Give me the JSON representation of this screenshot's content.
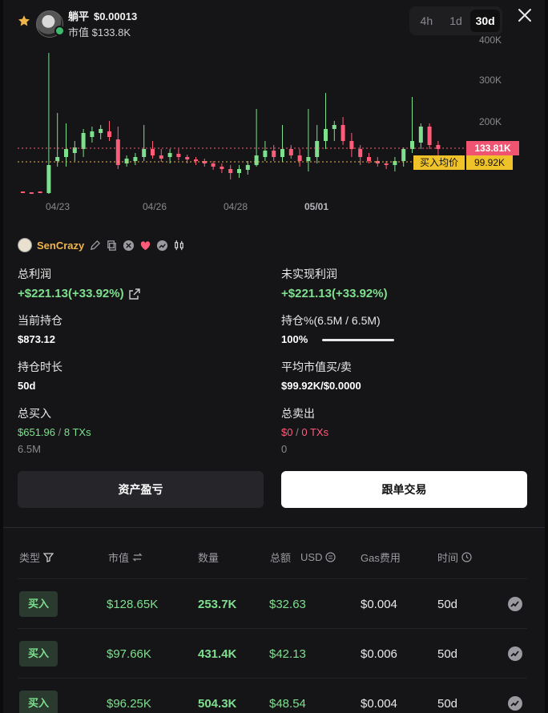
{
  "header": {
    "token_name": "躺平",
    "token_price": "$0.00013",
    "market_cap": "市值 $133.8K",
    "timeframes": [
      "4h",
      "1d",
      "30d"
    ],
    "active_timeframe": "30d"
  },
  "chart_data": {
    "type": "candlestick",
    "y_ticks": [
      "400K",
      "300K",
      "200K"
    ],
    "x_ticks": [
      "04/23",
      "04/26",
      "04/28",
      "05/01"
    ],
    "current_price_label": "133.81K",
    "avg_buy_label": "买入均价",
    "avg_buy_value": "99.92K",
    "up_color": "#7ee08f",
    "down_color": "#ff5c7a"
  },
  "trader": {
    "name": "SenCrazy"
  },
  "stats": {
    "total_profit_label": "总利润",
    "total_profit_value": "+$221.13(+33.92%)",
    "unrealized_label": "未实现利润",
    "unrealized_value": "+$221.13(+33.92%)",
    "holding_label": "当前持仓",
    "holding_value": "$873.12",
    "position_pct_label": "持仓%(6.5M / 6.5M)",
    "position_pct_value": "100%",
    "position_fraction": 1.0,
    "hold_time_label": "持仓时长",
    "hold_time_value": "50d",
    "avg_mcap_label": "平均市值买/卖",
    "avg_mcap_value": "$99.92K/$0.0000",
    "total_buy_label": "总买入",
    "total_buy_amount": "$651.96",
    "total_buy_sep": "/",
    "total_buy_txs": "8 TXs",
    "total_buy_qty": "6.5M",
    "total_sell_label": "总卖出",
    "total_sell_amount": "$0",
    "total_sell_sep": "/",
    "total_sell_txs": "0 TXs",
    "total_sell_qty": "0"
  },
  "buttons": {
    "pnl": "资产盈亏",
    "copy_trade": "跟单交易"
  },
  "table": {
    "headers": {
      "type": "类型",
      "mcap": "市值",
      "qty": "数量",
      "total": "总额",
      "total_unit": "USD",
      "gas": "Gas费用",
      "time": "时间"
    },
    "rows": [
      {
        "type": "买入",
        "mcap": "$128.65K",
        "qty": "253.7K",
        "total": "$32.63",
        "gas": "$0.004",
        "time": "50d"
      },
      {
        "type": "买入",
        "mcap": "$97.66K",
        "qty": "431.4K",
        "total": "$42.13",
        "gas": "$0.006",
        "time": "50d"
      },
      {
        "type": "买入",
        "mcap": "$96.25K",
        "qty": "504.3K",
        "total": "$48.54",
        "gas": "$0.004",
        "time": "50d"
      }
    ]
  }
}
